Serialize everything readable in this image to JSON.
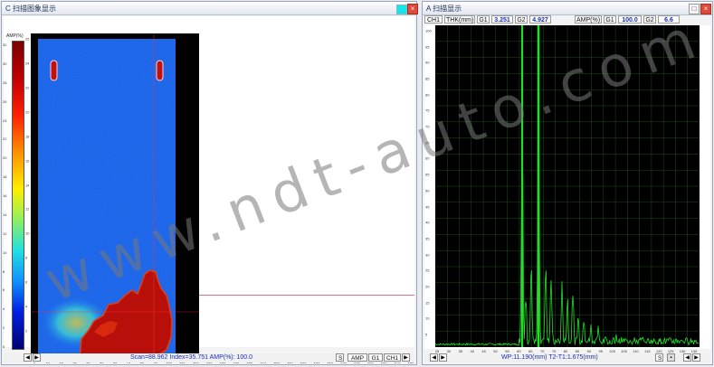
{
  "cscan_window": {
    "title": "C 扫描图象显示",
    "color_swatch": "#14e6ea",
    "colorbar_label": "AMP(%)",
    "colorbar_ticks": [
      "32",
      "30",
      "28",
      "26",
      "24",
      "22",
      "20",
      "18",
      "16",
      "14",
      "12",
      "10",
      "8",
      "6",
      "4",
      "2",
      "0"
    ],
    "x_ticks": [
      "0",
      "10",
      "20",
      "30",
      "40",
      "50",
      "60",
      "70",
      "80",
      "90",
      "100",
      "110",
      "120",
      "130",
      "140",
      "150",
      "160",
      "170",
      "180",
      "190",
      "200",
      "210",
      "220",
      "230",
      "240",
      "250",
      "260",
      "270",
      "280"
    ],
    "y_ticks": [
      "25",
      "24",
      "22",
      "20",
      "18",
      "16",
      "14",
      "12",
      "10",
      "8",
      "6",
      "4",
      "2",
      "0"
    ],
    "status": "Scan=88.962 Index=35.751  AMP(%): 100.0",
    "status_btns": [
      "S",
      "AMP",
      "G1",
      "CH1"
    ]
  },
  "ascan_window": {
    "title": "A 扫描显示",
    "params": [
      "CH1",
      "THK(mm)",
      "G1",
      "3.251",
      "G2",
      "4.927",
      "AMP(%)",
      "G1",
      "100.0",
      "G2",
      "6.6"
    ],
    "y_ticks": [
      "100",
      "95",
      "90",
      "85",
      "80",
      "75",
      "70",
      "65",
      "60",
      "55",
      "50",
      "45",
      "40",
      "35",
      "30",
      "25",
      "20",
      "15",
      "10",
      "5"
    ],
    "x_ticks": [
      "25",
      "30",
      "35",
      "40",
      "45",
      "50",
      "55",
      "60",
      "65",
      "70",
      "75",
      "80",
      "85",
      "90",
      "95",
      "100",
      "105",
      "110",
      "115",
      "120",
      "125",
      "130",
      "135"
    ],
    "status": "WP:11.190(mm)  T2-T1:1.675(mm)",
    "status_btns": [
      "S"
    ]
  },
  "watermark": "www.ndt-auto.com",
  "colors": {
    "accent": "#1a2fb8",
    "ascan_bg": "#000000",
    "ascan_signal": "#22e02a",
    "cscan_base": "#1060f0"
  }
}
